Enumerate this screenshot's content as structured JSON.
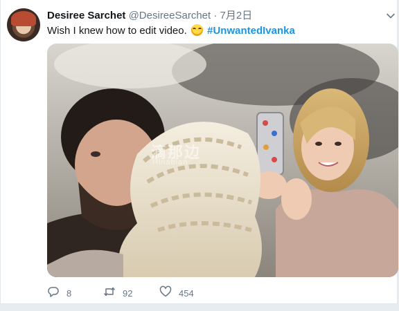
{
  "user": {
    "display_name": "Desiree Sarchet",
    "handle": "@DesireeSarchet",
    "separator": "·",
    "date": "7月2日"
  },
  "tweet": {
    "text": "Wish I knew how to edit video.",
    "emoji": "rolling-on-the-floor-laughing-emoji",
    "hashtag": "#UnwantedIvanka"
  },
  "media": {
    "watermark": "滴那边",
    "watermark_sub": "Hinabian"
  },
  "actions": {
    "reply_count": "8",
    "retweet_count": "92",
    "like_count": "454"
  },
  "colors": {
    "link": "#1b95e0",
    "secondary_text": "#657786",
    "primary_text": "#14171a"
  }
}
